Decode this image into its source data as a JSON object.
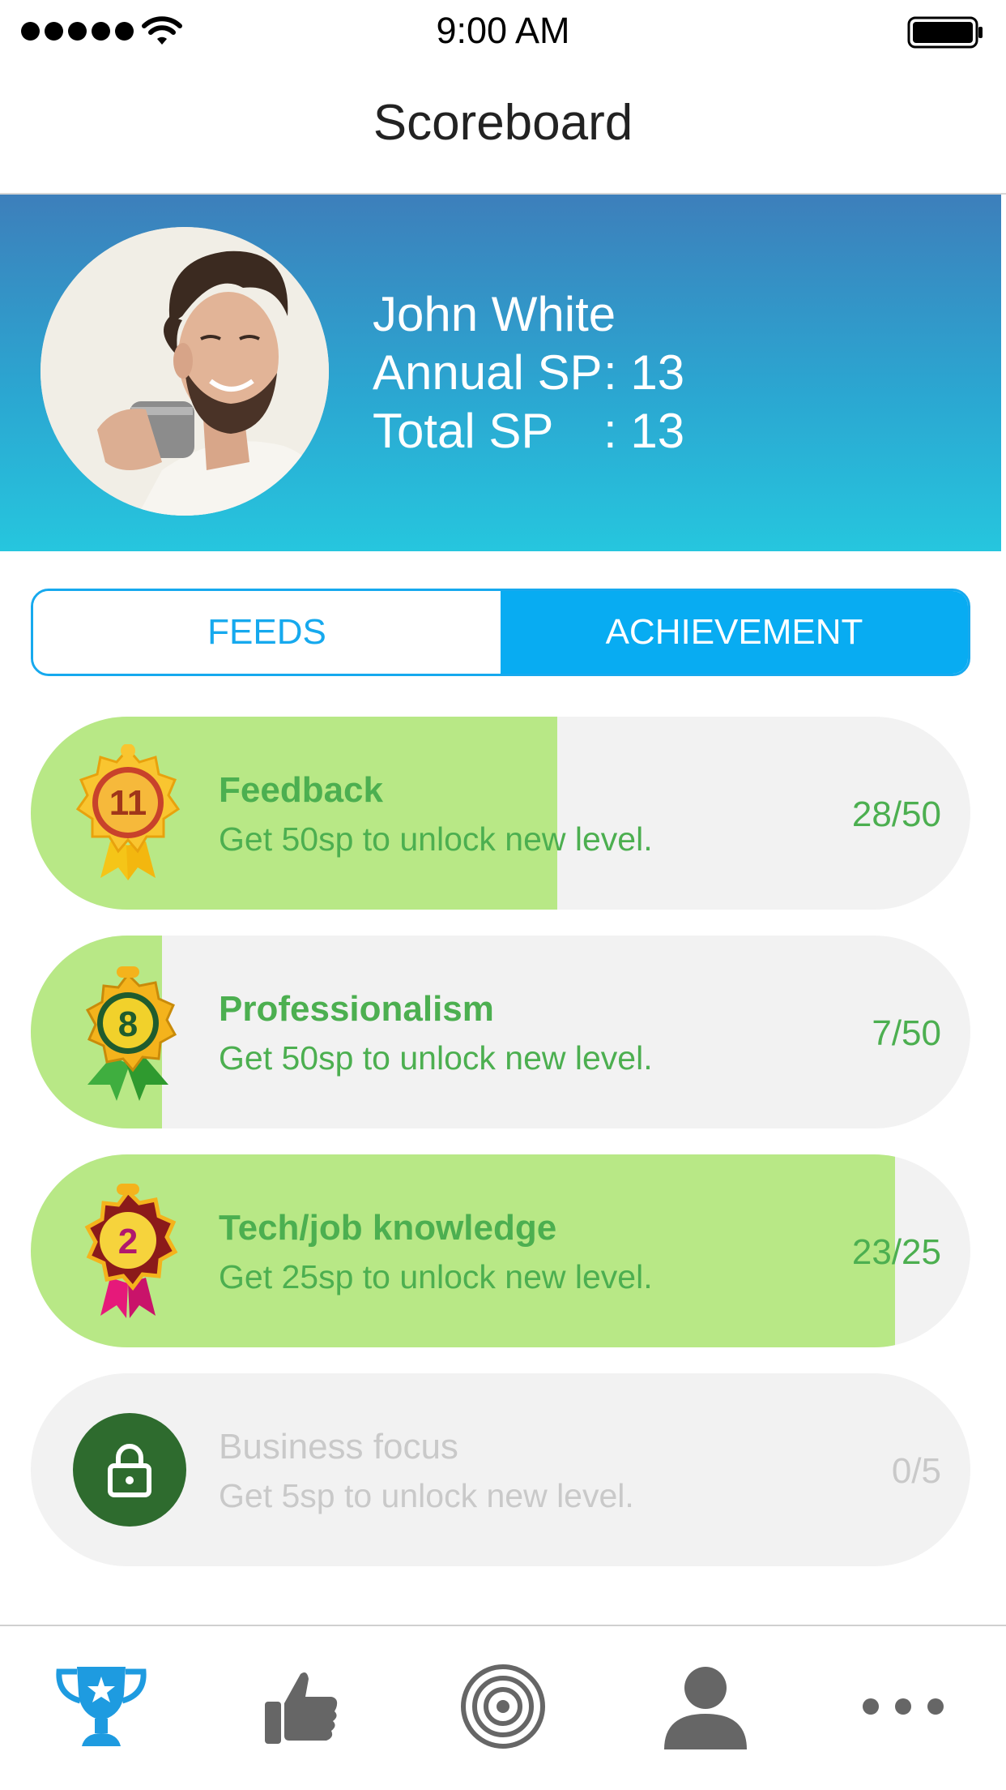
{
  "status_bar": {
    "time": "9:00 AM"
  },
  "page": {
    "title": "Scoreboard"
  },
  "profile": {
    "name": "John White",
    "annual_sp_label": "Annual SP",
    "annual_sp_value": ": 13",
    "total_sp_label": "Total SP",
    "total_sp_value": ": 13"
  },
  "segment": {
    "tabs": [
      {
        "label": "FEEDS",
        "selected": false
      },
      {
        "label": "ACHIEVEMENT",
        "selected": true
      }
    ]
  },
  "achievements": [
    {
      "title": "Feedback",
      "description": "Get 50sp to unlock new level.",
      "progress": "28/50",
      "fraction": 0.56,
      "badge_level": "11",
      "badge_icon": "gold-medal-icon",
      "locked": false
    },
    {
      "title": "Professionalism",
      "description": "Get 50sp to unlock new level.",
      "progress": "7/50",
      "fraction": 0.14,
      "badge_level": "8",
      "badge_icon": "green-medal-icon",
      "locked": false
    },
    {
      "title": "Tech/job knowledge",
      "description": "Get 25sp to unlock new level.",
      "progress": "23/25",
      "fraction": 0.92,
      "badge_level": "2",
      "badge_icon": "pink-medal-icon",
      "locked": false
    },
    {
      "title": "Business focus",
      "description": "Get 5sp to unlock new level.",
      "progress": "0/5",
      "fraction": 0,
      "badge_icon": "lock-icon",
      "locked": true
    }
  ],
  "tab_bar": {
    "items": [
      "trophy-icon",
      "thumbs-up-icon",
      "target-icon",
      "person-icon",
      "more-icon"
    ],
    "active": "trophy-icon",
    "active_color": "#1e9be0",
    "inactive_color": "#666666"
  },
  "colors": {
    "accent": "#08acf2",
    "progress_fill": "#b8e886",
    "progress_text": "#4caf50",
    "locked_text": "#c9c9c9"
  }
}
